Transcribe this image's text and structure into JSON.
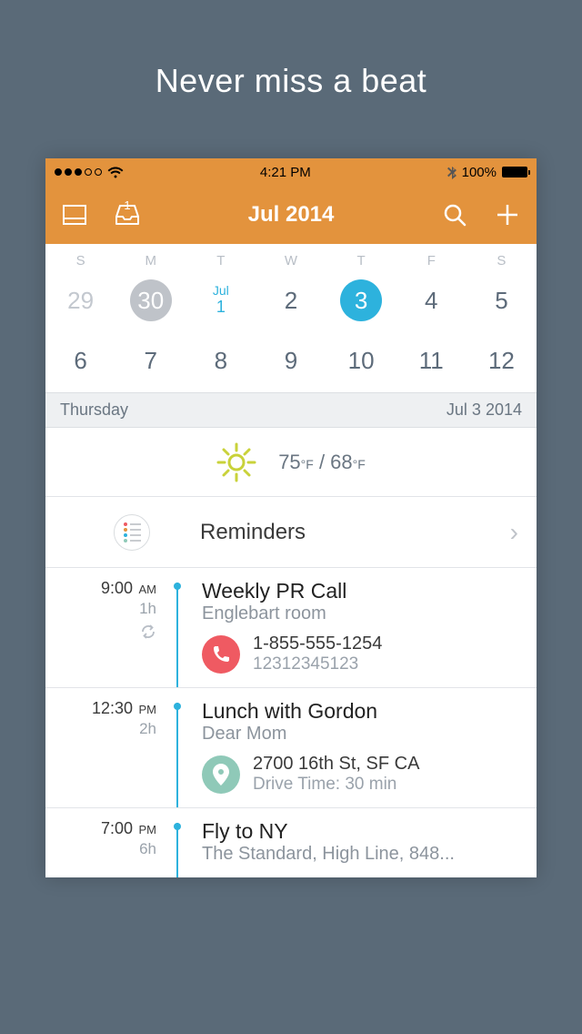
{
  "tagline": "Never miss a beat",
  "status": {
    "time": "4:21 PM",
    "battery_pct": "100%"
  },
  "nav": {
    "inbox_badge": "1",
    "title": "Jul 2014"
  },
  "week": {
    "day_labels": [
      "S",
      "M",
      "T",
      "W",
      "T",
      "F",
      "S"
    ],
    "row1": {
      "d0": "29",
      "d1": "30",
      "d2_month": "Jul",
      "d2_num": "1",
      "d3": "2",
      "d4": "3",
      "d5": "4",
      "d6": "5"
    },
    "row2": [
      "6",
      "7",
      "8",
      "9",
      "10",
      "11",
      "12"
    ]
  },
  "day_header": {
    "weekday": "Thursday",
    "date": "Jul 3 2014"
  },
  "weather": {
    "hi": "75",
    "hi_unit": "°F",
    "sep": " / ",
    "lo": "68",
    "lo_unit": "°F"
  },
  "reminders": {
    "label": "Reminders"
  },
  "events": [
    {
      "time": "9:00",
      "ampm": "AM",
      "duration": "1h",
      "recurring": true,
      "title": "Weekly PR Call",
      "subtitle": "Englebart room",
      "contact_type": "phone",
      "contact_l1": "1-855-555-1254",
      "contact_l2": "12312345123"
    },
    {
      "time": "12:30",
      "ampm": "PM",
      "duration": "2h",
      "recurring": false,
      "title": "Lunch with Gordon",
      "subtitle": "Dear Mom",
      "contact_type": "location",
      "contact_l1": "2700 16th St, SF CA",
      "contact_l2": "Drive Time: 30 min"
    },
    {
      "time": "7:00",
      "ampm": "PM",
      "duration": "6h",
      "recurring": false,
      "title": "Fly to NY",
      "subtitle": "The Standard, High Line, 848...",
      "contact_type": null
    }
  ]
}
